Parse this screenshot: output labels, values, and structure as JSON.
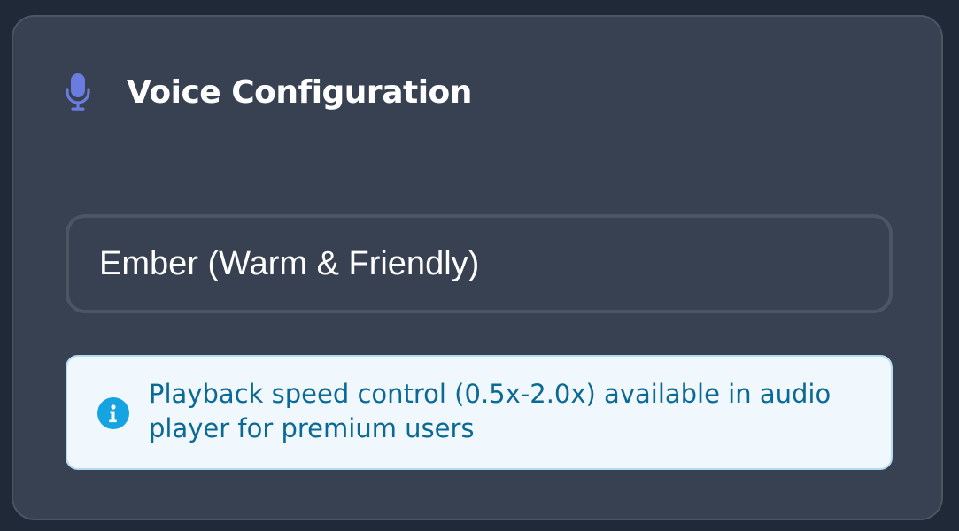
{
  "panel": {
    "title": "Voice Configuration",
    "icon": "microphone-icon",
    "accent_color": "#6b7ce0"
  },
  "voice_select": {
    "selected_value": "Ember (Warm & Friendly)"
  },
  "info_notice": {
    "icon": "info-icon",
    "text": "Playback speed control (0.5x-2.0x) available in audio player for premium users",
    "icon_color": "#16a3e2",
    "text_color": "#0b6a95"
  }
}
